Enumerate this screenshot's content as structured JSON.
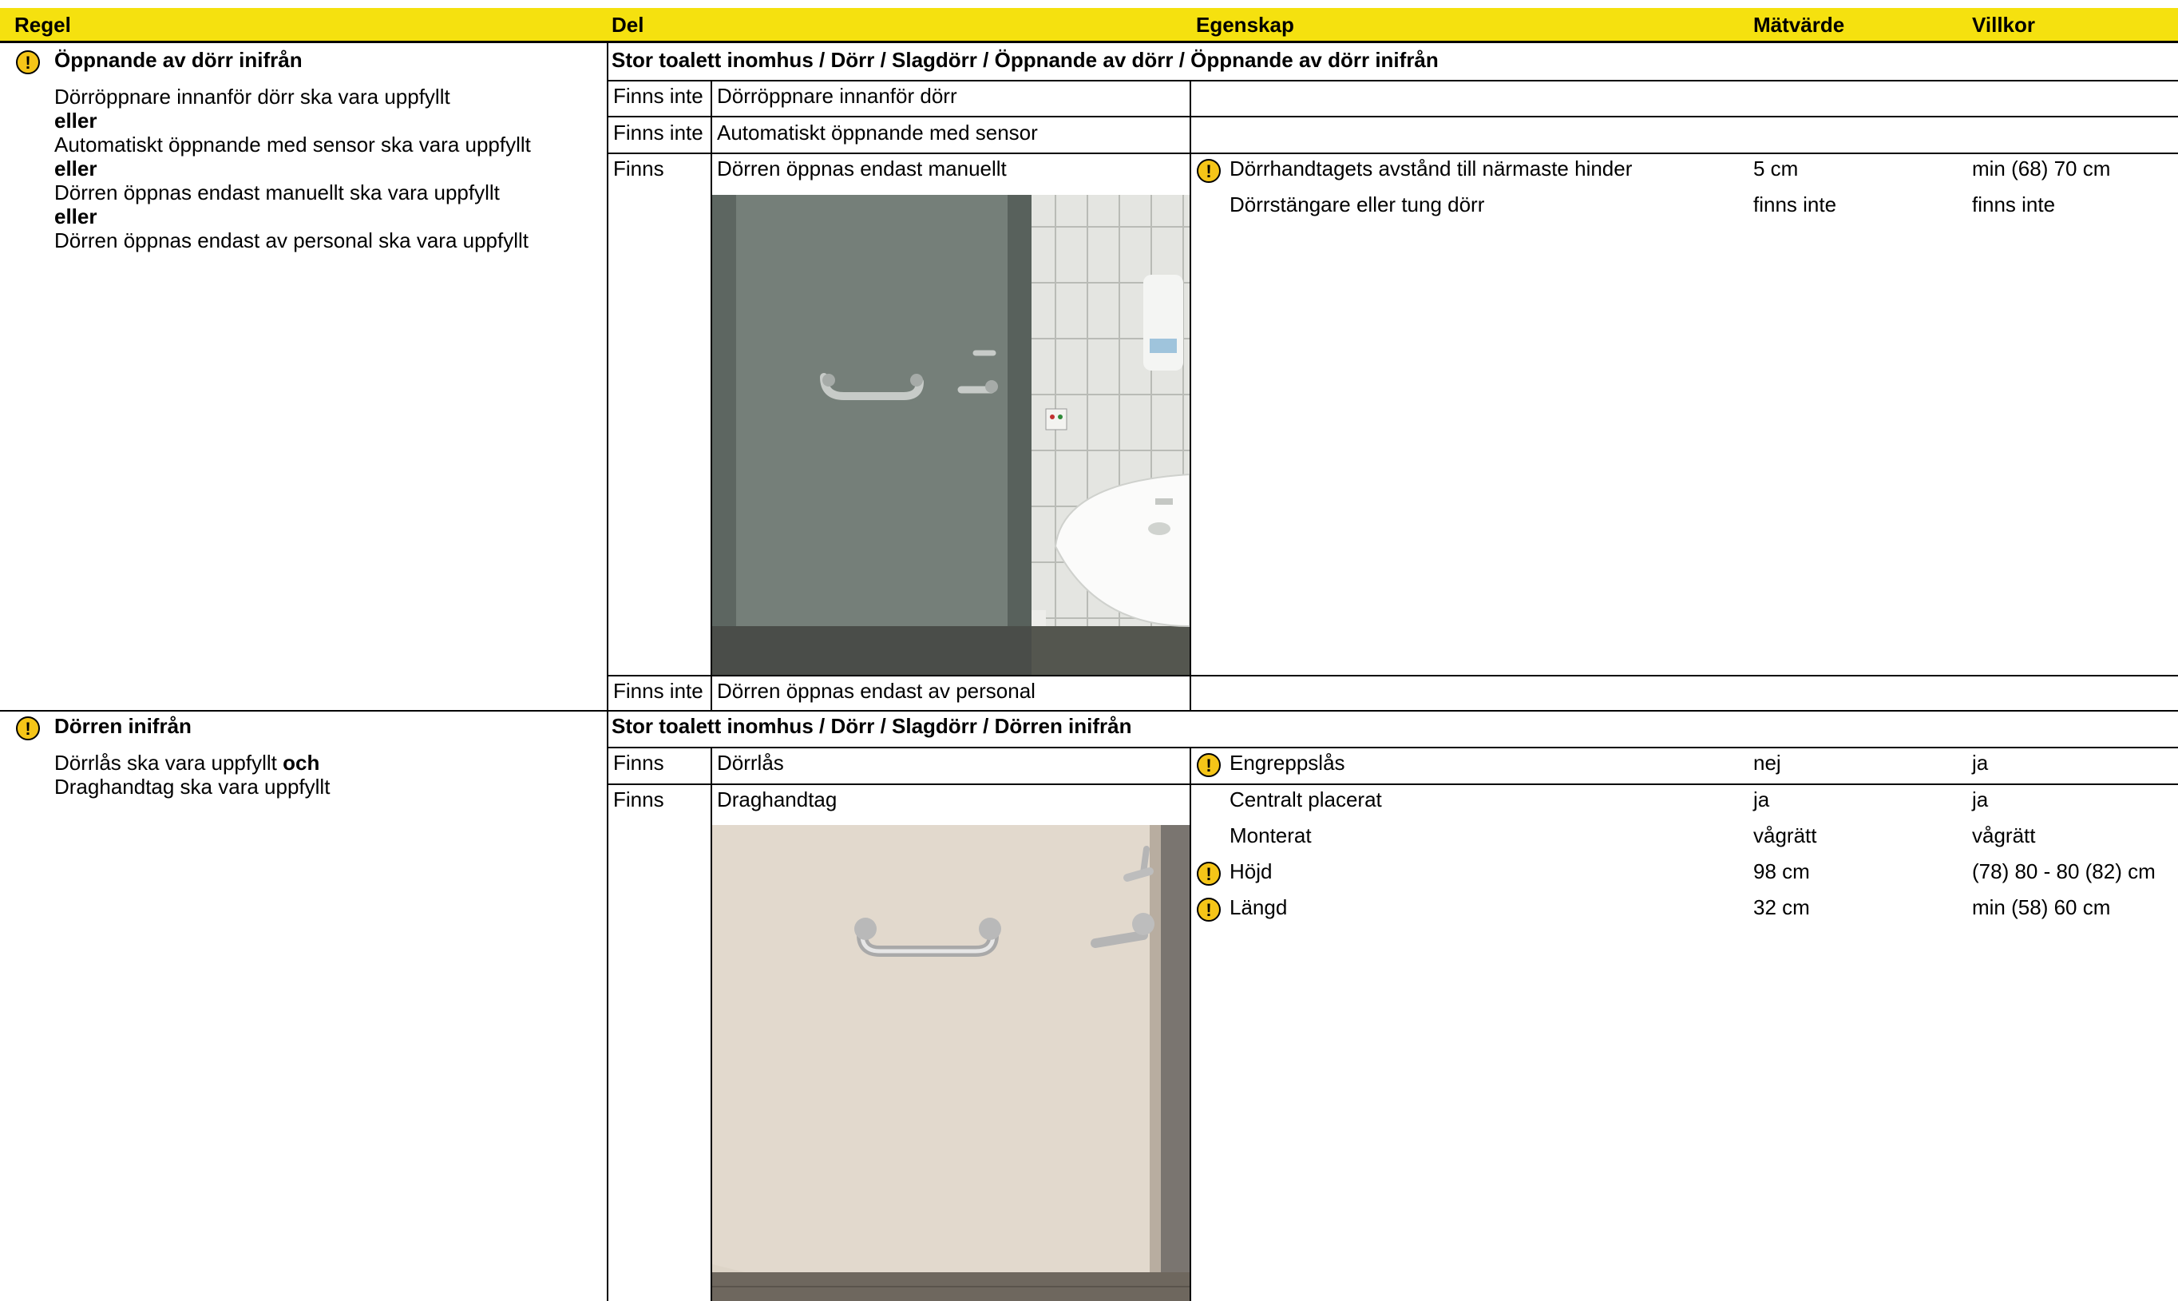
{
  "header": {
    "col_regel": "Regel",
    "col_del": "Del",
    "col_egenskap": "Egenskap",
    "col_matvarde": "Mätvärde",
    "col_villkor": "Villkor"
  },
  "rules": [
    {
      "title": "Öppnande av dörr inifrån",
      "lines": [
        "Dörröppnare innanför dörr ska vara uppfyllt",
        "eller",
        "Automatiskt öppnande med sensor ska vara uppfyllt",
        "eller",
        "Dörren öppnas endast manuellt ska vara uppfyllt",
        "eller",
        "Dörren öppnas endast av personal ska vara uppfyllt"
      ],
      "path": "Stor toalett inomhus / Dörr / Slagdörr / Öppnande av dörr / Öppnande av dörr inifrån",
      "parts": [
        {
          "status": "Finns inte",
          "name": "Dörröppnare innanför dörr"
        },
        {
          "status": "Finns inte",
          "name": "Automatiskt öppnande med sensor"
        },
        {
          "status": "Finns",
          "name": "Dörren öppnas endast manuellt",
          "properties": [
            {
              "warning": true,
              "name": "Dörrhandtagets avstånd till närmaste hinder",
              "value": "5 cm",
              "condition": "min (68) 70 cm"
            },
            {
              "warning": false,
              "name": "Dörrstängare eller tung dörr",
              "value": "finns inte",
              "condition": "finns inte"
            }
          ]
        },
        {
          "status": "Finns inte",
          "name": "Dörren öppnas endast av personal"
        }
      ]
    },
    {
      "title": "Dörren inifrån",
      "line1_a": "Dörrlås ska vara uppfyllt ",
      "line1_b": "och",
      "line2": "Draghandtag ska vara uppfyllt",
      "path": "Stor toalett inomhus / Dörr / Slagdörr / Dörren inifrån",
      "parts": [
        {
          "status": "Finns",
          "name": "Dörrlås",
          "properties": [
            {
              "warning": true,
              "name": "Engreppslås",
              "value": "nej",
              "condition": "ja"
            }
          ]
        },
        {
          "status": "Finns",
          "name": "Draghandtag",
          "properties": [
            {
              "warning": false,
              "name": "Centralt placerat",
              "value": "ja",
              "condition": "ja"
            },
            {
              "warning": false,
              "name": "Monterat",
              "value": "vågrätt",
              "condition": "vågrätt"
            },
            {
              "warning": true,
              "name": "Höjd",
              "value": "98 cm",
              "condition": "(78) 80 - 80 (82) cm"
            },
            {
              "warning": true,
              "name": "Längd",
              "value": "32 cm",
              "condition": "min (58) 60 cm"
            }
          ]
        }
      ]
    }
  ],
  "icons": {
    "warning": "warning-icon",
    "warning_glyph": "!"
  },
  "colors": {
    "header_bg": "#f5e10f",
    "warning_bg": "#f5c518"
  }
}
